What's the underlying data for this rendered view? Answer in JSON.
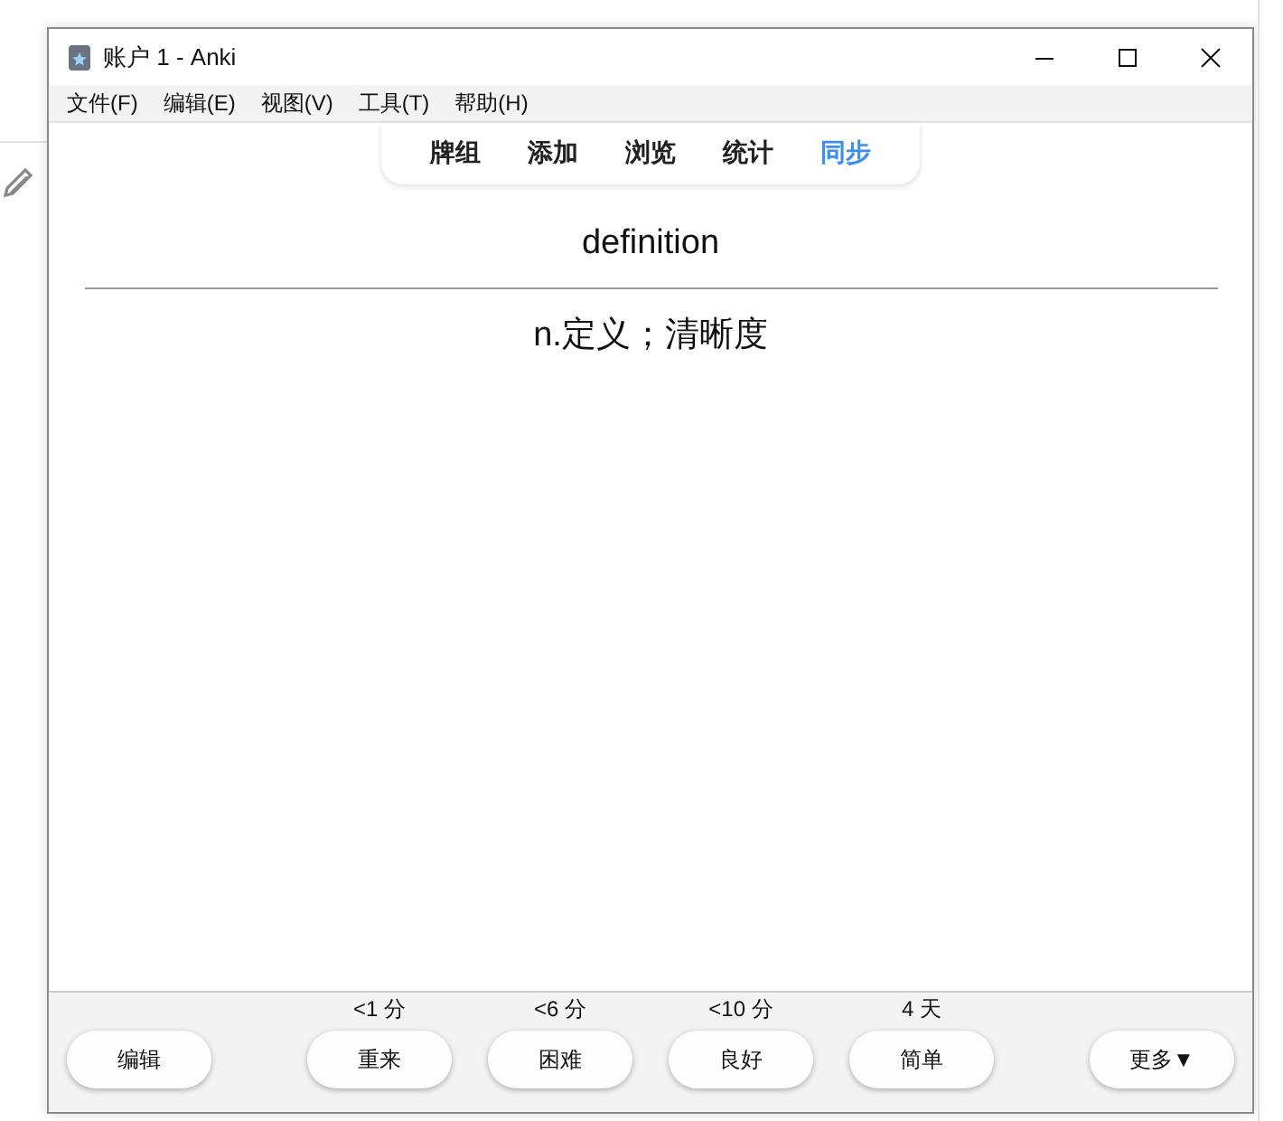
{
  "window": {
    "title": "账户 1 - Anki"
  },
  "menu": [
    "文件(F)",
    "编辑(E)",
    "视图(V)",
    "工具(T)",
    "帮助(H)"
  ],
  "tabs": [
    {
      "label": "牌组",
      "selected": false
    },
    {
      "label": "添加",
      "selected": false
    },
    {
      "label": "浏览",
      "selected": false
    },
    {
      "label": "统计",
      "selected": false
    },
    {
      "label": "同步",
      "selected": true
    }
  ],
  "card": {
    "question": "definition",
    "answer": "n.定义；清晰度"
  },
  "bottom_bar": {
    "edit_button": "编辑",
    "answers": [
      {
        "interval": "<1 分",
        "label": "重来"
      },
      {
        "interval": "<6 分",
        "label": "困难"
      },
      {
        "interval": "<10 分",
        "label": "良好"
      },
      {
        "interval": "4 天",
        "label": "简单"
      }
    ],
    "more_button": "更多▼"
  }
}
